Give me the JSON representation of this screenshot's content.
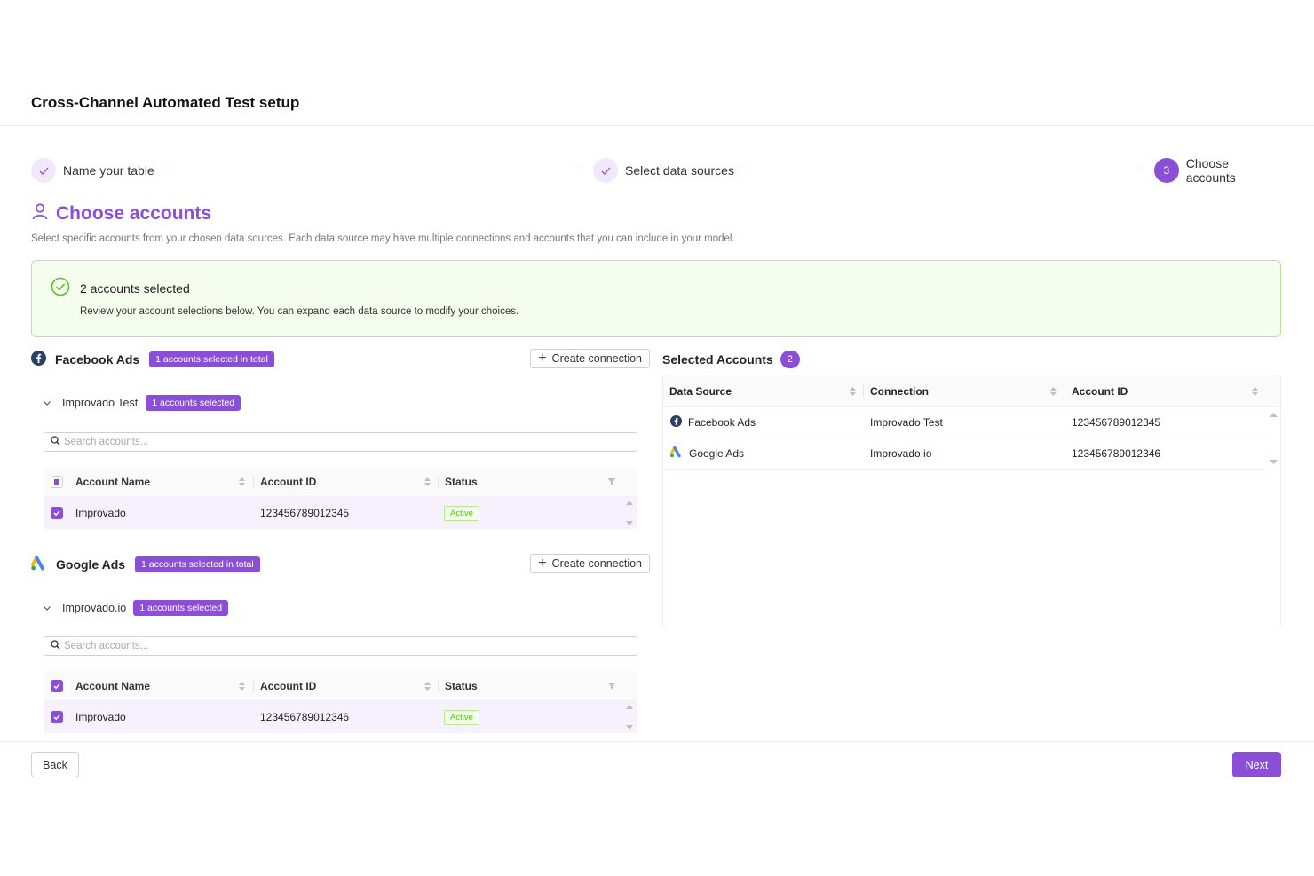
{
  "header": {
    "title": "Cross-Channel Automated Test setup"
  },
  "stepper": {
    "steps": [
      {
        "label": "Name your table",
        "status": "done"
      },
      {
        "label": "Select data sources",
        "status": "done"
      },
      {
        "label": "Choose accounts",
        "status": "active",
        "number": "3"
      }
    ]
  },
  "section": {
    "title": "Choose accounts",
    "description": "Select specific accounts from your chosen data sources. Each data source may have multiple connections and accounts that you can include in your model."
  },
  "banner": {
    "title": "2 accounts selected",
    "text": "Review your account selections below. You can expand each data source to modify your choices."
  },
  "sources": [
    {
      "name": "Facebook Ads",
      "icon": "facebook-icon",
      "total_badge": "1 accounts selected in total",
      "create_label": "Create connection",
      "connection": {
        "name": "Improvado Test",
        "badge": "1 accounts selected",
        "search_placeholder": "Search accounts...",
        "columns": [
          "Account Name",
          "Account ID",
          "Status"
        ],
        "rows": [
          {
            "name": "Improvado",
            "id": "123456789012345",
            "status": "Active",
            "checked": true
          }
        ]
      }
    },
    {
      "name": "Google Ads",
      "icon": "google-ads-icon",
      "total_badge": "1 accounts selected in total",
      "create_label": "Create connection",
      "connection": {
        "name": "Improvado.io",
        "badge": "1 accounts selected",
        "search_placeholder": "Search accounts...",
        "columns": [
          "Account Name",
          "Account ID",
          "Status"
        ],
        "rows": [
          {
            "name": "Improvado",
            "id": "123456789012346",
            "status": "Active",
            "checked": true
          }
        ]
      }
    }
  ],
  "selected": {
    "title": "Selected Accounts",
    "count": "2",
    "columns": [
      "Data Source",
      "Connection",
      "Account ID"
    ],
    "rows": [
      {
        "source": "Facebook Ads",
        "icon": "facebook-icon",
        "connection": "Improvado Test",
        "id": "123456789012345"
      },
      {
        "source": "Google Ads",
        "icon": "google-ads-icon",
        "connection": "Improvado.io",
        "id": "123456789012346"
      }
    ]
  },
  "footer": {
    "back_label": "Back",
    "next_label": "Next"
  },
  "colors": {
    "accent": "#8a4fd6",
    "success_bg": "#f4fdee",
    "success_border": "#b6e59a",
    "active_tag": "#52c41a"
  }
}
